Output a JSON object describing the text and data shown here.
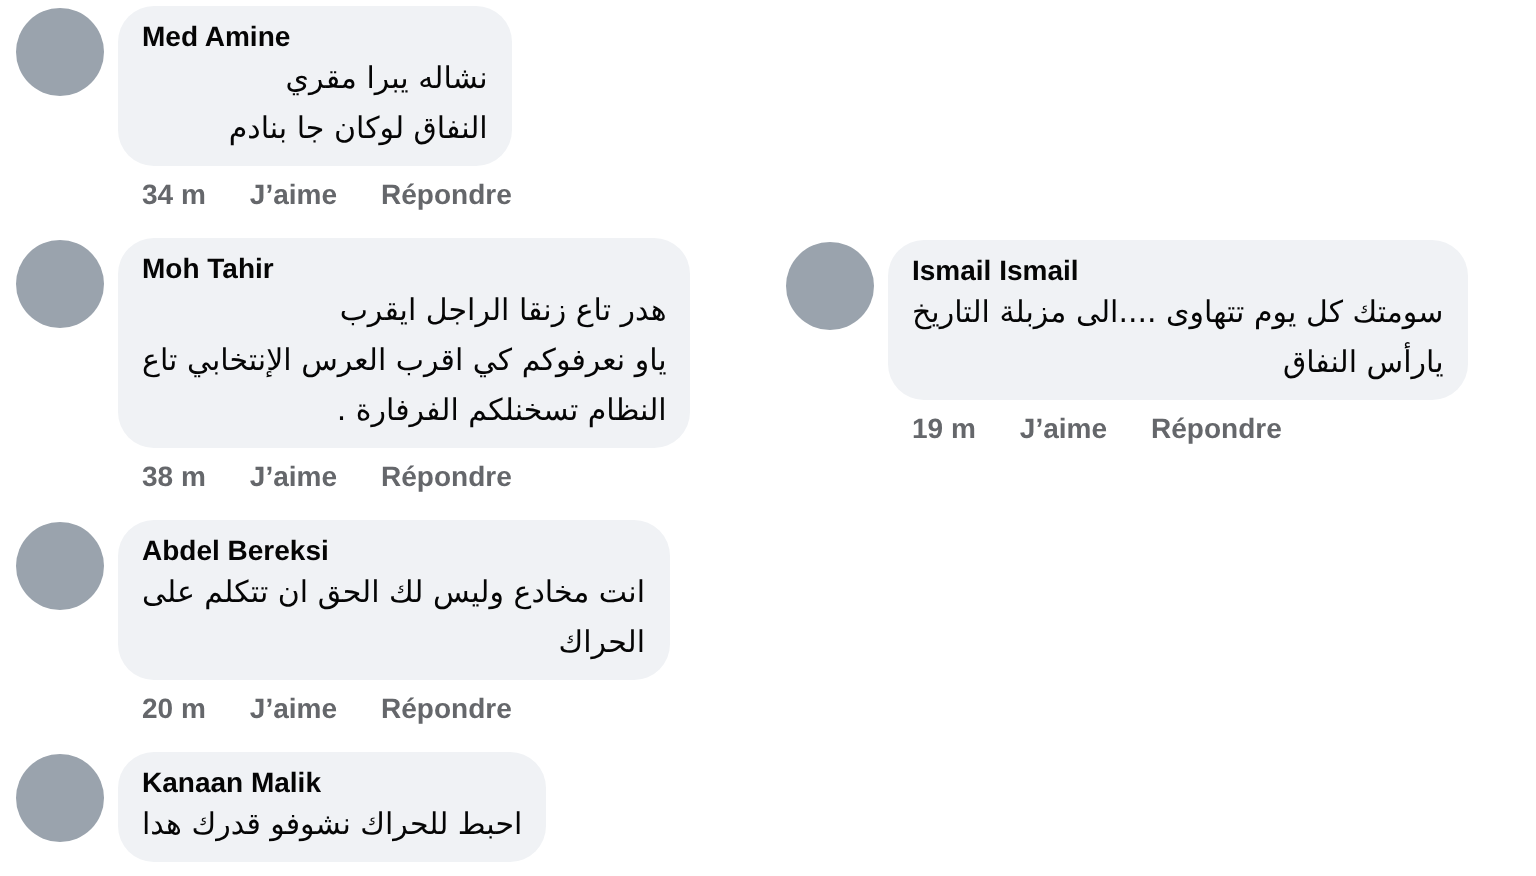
{
  "columns": [
    {
      "comments": [
        {
          "author": "Med Amine",
          "lines": [
            "نشاله يبرا مقري",
            "النفاق لوكان جا بنادم"
          ],
          "time": "34 m",
          "like": "J’aime",
          "reply": "Répondre"
        },
        {
          "author": "Moh Tahir",
          "lines": [
            "هدر تاع زنقا الراجل ايقرب",
            "ياو نعرفوكم كي اقرب العرس الإنتخابي تاع",
            "النظام تسخنلكم الفرفارة ."
          ],
          "time": "38 m",
          "like": "J’aime",
          "reply": "Répondre"
        },
        {
          "author": "Abdel Bereksi",
          "lines": [
            "انت مخادع وليس لك الحق ان تتكلم على",
            "الحراك"
          ],
          "time": "20 m",
          "like": "J’aime",
          "reply": "Répondre"
        },
        {
          "author": "Kanaan Malik",
          "lines": [
            "احبط للحراك نشوفو قدرك هدا"
          ]
        }
      ]
    },
    {
      "comments": [
        {
          "author": "Ismail Ismail",
          "lines": [
            "سومتك كل يوم تتهاوى ....الى مزبلة التاريخ",
            "يارأس النفاق"
          ],
          "time": "19 m",
          "like": "J’aime",
          "reply": "Répondre"
        }
      ]
    }
  ]
}
